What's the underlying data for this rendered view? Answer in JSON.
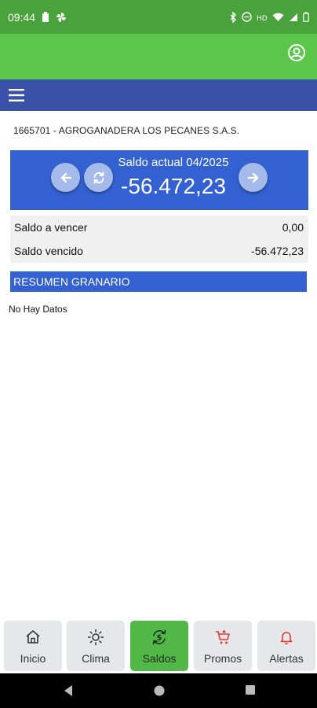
{
  "status_bar": {
    "time": "09:44"
  },
  "client": {
    "line": "1665701 - AGROGANADERA LOS PECANES S.A.S."
  },
  "balance": {
    "title": "Saldo actual 04/2025",
    "value": "-56.472,23"
  },
  "rows": [
    {
      "label": "Saldo a vencer",
      "value": "0,00"
    },
    {
      "label": "Saldo vencido",
      "value": "-56.472,23"
    }
  ],
  "section": {
    "title": "RESUMEN GRANARIO",
    "empty_text": "No Hay Datos"
  },
  "tabs": [
    {
      "label": "Inicio",
      "icon": "home-icon"
    },
    {
      "label": "Clima",
      "icon": "sun-icon"
    },
    {
      "label": "Saldos",
      "icon": "dollar-refresh-icon",
      "active": true
    },
    {
      "label": "Promos",
      "icon": "cart-icon"
    },
    {
      "label": "Alertas",
      "icon": "bell-icon"
    }
  ],
  "colors": {
    "status_green": "#4aa23c",
    "app_green": "#5ac64a",
    "nav_blue": "#3952a8",
    "card_blue": "#3461d1",
    "active_tab": "#51b848",
    "accent_red": "#e53935"
  }
}
